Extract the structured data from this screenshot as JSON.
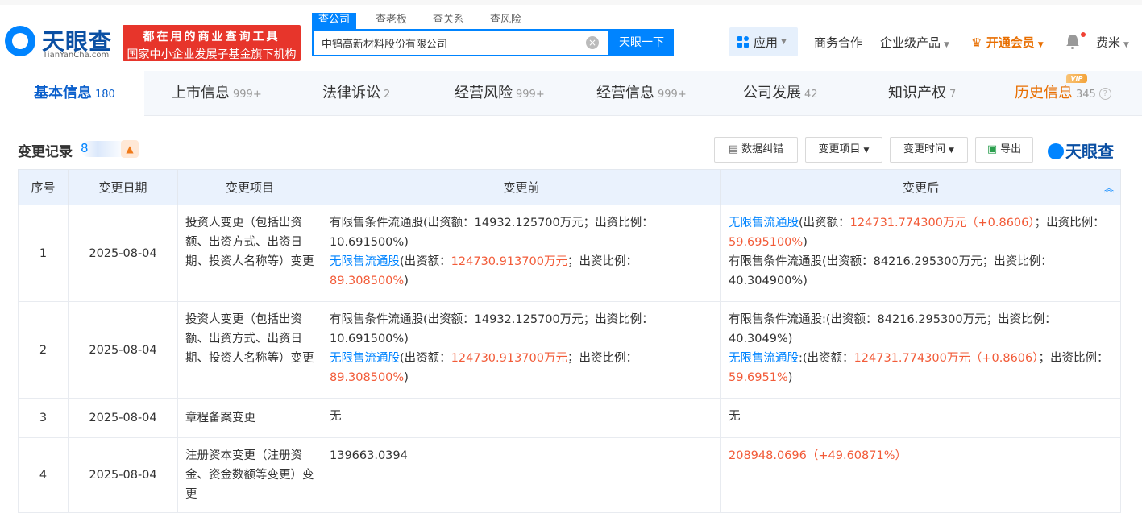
{
  "header": {
    "logo_text": "天眼查",
    "logo_sub": "TianYanCha.com",
    "promo_line1": "都在用的商业查询工具",
    "promo_line2": "国家中小企业发展子基金旗下机构",
    "search_tabs": [
      "查公司",
      "查老板",
      "查关系",
      "查风险"
    ],
    "search_value": "中钨高新材料股份有限公司",
    "search_button": "天眼一下",
    "nav_app": "应用",
    "nav_items": [
      "商务合作",
      "企业级产品",
      "开通会员"
    ],
    "user_name": "费米"
  },
  "tabs": [
    {
      "label": "基本信息",
      "count": "180"
    },
    {
      "label": "上市信息",
      "count": "999+"
    },
    {
      "label": "法律诉讼",
      "count": "2"
    },
    {
      "label": "经营风险",
      "count": "999+"
    },
    {
      "label": "经营信息",
      "count": "999+"
    },
    {
      "label": "公司发展",
      "count": "42"
    },
    {
      "label": "知识产权",
      "count": "7"
    },
    {
      "label": "历史信息",
      "count": "345"
    }
  ],
  "vip_tag": "VIP",
  "section": {
    "title": "变更记录",
    "count": "8",
    "toolbar": {
      "correction": "数据纠错",
      "change_item": "变更项目",
      "change_time": "变更时间",
      "export": "导出"
    },
    "brand": "天眼查"
  },
  "table": {
    "headers": [
      "序号",
      "变更日期",
      "变更项目",
      "变更前",
      "变更后"
    ],
    "rows": [
      {
        "no": "1",
        "date": "2025-08-04",
        "item": "投资人变更（包括出资额、出资方式、出资日期、投资人名称等）变更",
        "before": [
          {
            "a": "有限售条件流通股(出资额：14932.125700万元；出资比例：10.691500%)"
          },
          {
            "link": "无限售流通股",
            "b": "(出资额：",
            "amt": "124730.913700万元",
            "c": "；出资比例：",
            "pct": "89.308500%",
            "d": ")"
          }
        ],
        "after": [
          {
            "link": "无限售流通股",
            "b": "(出资额：",
            "amt": "124731.774300万元（+0.8606）",
            "c": "；出资比例：",
            "pct": "59.695100%",
            "d": ")"
          },
          {
            "a": "有限售条件流通股(出资额：84216.295300万元；出资比例：40.304900%)"
          }
        ]
      },
      {
        "no": "2",
        "date": "2025-08-04",
        "item": "投资人变更（包括出资额、出资方式、出资日期、投资人名称等）变更",
        "before": [
          {
            "a": "有限售条件流通股(出资额：14932.125700万元；出资比例：10.691500%)"
          },
          {
            "link": "无限售流通股",
            "b": "(出资额：",
            "amt": "124730.913700万元",
            "c": "；出资比例：",
            "pct": "89.308500%",
            "d": ")"
          }
        ],
        "after": [
          {
            "a": "有限售条件流通股:(出资额：84216.295300万元；出资比例：40.3049%)"
          },
          {
            "link": "无限售流通股",
            "b": ":(出资额：",
            "amt": "124731.774300万元（+0.8606）",
            "c": "；出资比例：",
            "pct": "59.6951%",
            "d": ")"
          }
        ]
      },
      {
        "no": "3",
        "date": "2025-08-04",
        "item": "章程备案变更",
        "before_text": "无",
        "after_text": "无"
      },
      {
        "no": "4",
        "date": "2025-08-04",
        "item": "注册资本变更（注册资金、资金数额等变更）变更",
        "before_text": "139663.0394",
        "after_red": "208948.0696（+49.60871%）"
      }
    ]
  }
}
